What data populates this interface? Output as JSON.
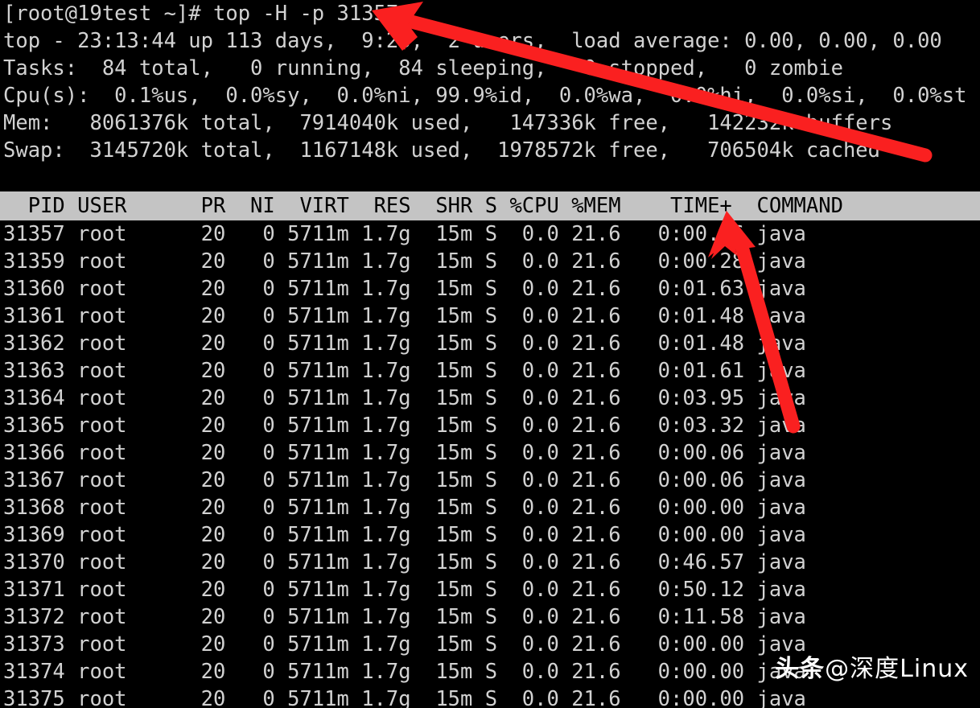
{
  "terminal": {
    "prompt_line": "[root@19test ~]# top -H -p 31357",
    "summary": [
      "top - 23:13:44 up 113 days,  9:23,  2 users,  load average: 0.00, 0.00, 0.00",
      "Tasks:  84 total,   0 running,  84 sleeping,   0 stopped,   0 zombie",
      "Cpu(s):  0.1%us,  0.0%sy,  0.0%ni, 99.9%id,  0.0%wa,  0.0%hi,  0.0%si,  0.0%st",
      "Mem:   8061376k total,  7914040k used,   147336k free,   142232k buffers",
      "Swap:  3145720k total,  1167148k used,  1978572k free,   706504k cached"
    ],
    "blank_line": "",
    "column_header": "  PID USER      PR  NI  VIRT  RES  SHR S %CPU %MEM    TIME+  COMMAND",
    "columns": [
      "PID",
      "USER",
      "PR",
      "NI",
      "VIRT",
      "RES",
      "SHR",
      "S",
      "%CPU",
      "%MEM",
      "TIME+",
      "COMMAND"
    ],
    "rows": [
      {
        "line": "31357 root      20   0 5711m 1.7g  15m S  0.0 21.6   0:00.16 java",
        "pid": "31357",
        "user": "root",
        "pr": "20",
        "ni": "0",
        "virt": "5711m",
        "res": "1.7g",
        "shr": "15m",
        "s": "S",
        "cpu": "0.0",
        "mem": "21.6",
        "time": "0:00.16",
        "command": "java"
      },
      {
        "line": "31359 root      20   0 5711m 1.7g  15m S  0.0 21.6   0:00.28 java",
        "pid": "31359",
        "user": "root",
        "pr": "20",
        "ni": "0",
        "virt": "5711m",
        "res": "1.7g",
        "shr": "15m",
        "s": "S",
        "cpu": "0.0",
        "mem": "21.6",
        "time": "0:00.28",
        "command": "java"
      },
      {
        "line": "31360 root      20   0 5711m 1.7g  15m S  0.0 21.6   0:01.63 java",
        "pid": "31360",
        "user": "root",
        "pr": "20",
        "ni": "0",
        "virt": "5711m",
        "res": "1.7g",
        "shr": "15m",
        "s": "S",
        "cpu": "0.0",
        "mem": "21.6",
        "time": "0:01.63",
        "command": "java"
      },
      {
        "line": "31361 root      20   0 5711m 1.7g  15m S  0.0 21.6   0:01.48 java",
        "pid": "31361",
        "user": "root",
        "pr": "20",
        "ni": "0",
        "virt": "5711m",
        "res": "1.7g",
        "shr": "15m",
        "s": "S",
        "cpu": "0.0",
        "mem": "21.6",
        "time": "0:01.48",
        "command": "java"
      },
      {
        "line": "31362 root      20   0 5711m 1.7g  15m S  0.0 21.6   0:01.48 java",
        "pid": "31362",
        "user": "root",
        "pr": "20",
        "ni": "0",
        "virt": "5711m",
        "res": "1.7g",
        "shr": "15m",
        "s": "S",
        "cpu": "0.0",
        "mem": "21.6",
        "time": "0:01.48",
        "command": "java"
      },
      {
        "line": "31363 root      20   0 5711m 1.7g  15m S  0.0 21.6   0:01.61 java",
        "pid": "31363",
        "user": "root",
        "pr": "20",
        "ni": "0",
        "virt": "5711m",
        "res": "1.7g",
        "shr": "15m",
        "s": "S",
        "cpu": "0.0",
        "mem": "21.6",
        "time": "0:01.61",
        "command": "java"
      },
      {
        "line": "31364 root      20   0 5711m 1.7g  15m S  0.0 21.6   0:03.95 java",
        "pid": "31364",
        "user": "root",
        "pr": "20",
        "ni": "0",
        "virt": "5711m",
        "res": "1.7g",
        "shr": "15m",
        "s": "S",
        "cpu": "0.0",
        "mem": "21.6",
        "time": "0:03.95",
        "command": "java"
      },
      {
        "line": "31365 root      20   0 5711m 1.7g  15m S  0.0 21.6   0:03.32 java",
        "pid": "31365",
        "user": "root",
        "pr": "20",
        "ni": "0",
        "virt": "5711m",
        "res": "1.7g",
        "shr": "15m",
        "s": "S",
        "cpu": "0.0",
        "mem": "21.6",
        "time": "0:03.32",
        "command": "java"
      },
      {
        "line": "31366 root      20   0 5711m 1.7g  15m S  0.0 21.6   0:00.06 java",
        "pid": "31366",
        "user": "root",
        "pr": "20",
        "ni": "0",
        "virt": "5711m",
        "res": "1.7g",
        "shr": "15m",
        "s": "S",
        "cpu": "0.0",
        "mem": "21.6",
        "time": "0:00.06",
        "command": "java"
      },
      {
        "line": "31367 root      20   0 5711m 1.7g  15m S  0.0 21.6   0:00.06 java",
        "pid": "31367",
        "user": "root",
        "pr": "20",
        "ni": "0",
        "virt": "5711m",
        "res": "1.7g",
        "shr": "15m",
        "s": "S",
        "cpu": "0.0",
        "mem": "21.6",
        "time": "0:00.06",
        "command": "java"
      },
      {
        "line": "31368 root      20   0 5711m 1.7g  15m S  0.0 21.6   0:00.00 java",
        "pid": "31368",
        "user": "root",
        "pr": "20",
        "ni": "0",
        "virt": "5711m",
        "res": "1.7g",
        "shr": "15m",
        "s": "S",
        "cpu": "0.0",
        "mem": "21.6",
        "time": "0:00.00",
        "command": "java"
      },
      {
        "line": "31369 root      20   0 5711m 1.7g  15m S  0.0 21.6   0:00.00 java",
        "pid": "31369",
        "user": "root",
        "pr": "20",
        "ni": "0",
        "virt": "5711m",
        "res": "1.7g",
        "shr": "15m",
        "s": "S",
        "cpu": "0.0",
        "mem": "21.6",
        "time": "0:00.00",
        "command": "java"
      },
      {
        "line": "31370 root      20   0 5711m 1.7g  15m S  0.0 21.6   0:46.57 java",
        "pid": "31370",
        "user": "root",
        "pr": "20",
        "ni": "0",
        "virt": "5711m",
        "res": "1.7g",
        "shr": "15m",
        "s": "S",
        "cpu": "0.0",
        "mem": "21.6",
        "time": "0:46.57",
        "command": "java"
      },
      {
        "line": "31371 root      20   0 5711m 1.7g  15m S  0.0 21.6   0:50.12 java",
        "pid": "31371",
        "user": "root",
        "pr": "20",
        "ni": "0",
        "virt": "5711m",
        "res": "1.7g",
        "shr": "15m",
        "s": "S",
        "cpu": "0.0",
        "mem": "21.6",
        "time": "0:50.12",
        "command": "java"
      },
      {
        "line": "31372 root      20   0 5711m 1.7g  15m S  0.0 21.6   0:11.58 java",
        "pid": "31372",
        "user": "root",
        "pr": "20",
        "ni": "0",
        "virt": "5711m",
        "res": "1.7g",
        "shr": "15m",
        "s": "S",
        "cpu": "0.0",
        "mem": "21.6",
        "time": "0:11.58",
        "command": "java"
      },
      {
        "line": "31373 root      20   0 5711m 1.7g  15m S  0.0 21.6   0:00.00 java",
        "pid": "31373",
        "user": "root",
        "pr": "20",
        "ni": "0",
        "virt": "5711m",
        "res": "1.7g",
        "shr": "15m",
        "s": "S",
        "cpu": "0.0",
        "mem": "21.6",
        "time": "0:00.00",
        "command": "java"
      },
      {
        "line": "31374 root      20   0 5711m 1.7g  15m S  0.0 21.6   0:00.00 java",
        "pid": "31374",
        "user": "root",
        "pr": "20",
        "ni": "0",
        "virt": "5711m",
        "res": "1.7g",
        "shr": "15m",
        "s": "S",
        "cpu": "0.0",
        "mem": "21.6",
        "time": "0:00.00",
        "command": "java"
      },
      {
        "line": "31375 root      20   0 5711m 1.7g  15m S  0.0 21.6   0:00.00 java",
        "pid": "31375",
        "user": "root",
        "pr": "20",
        "ni": "0",
        "virt": "5711m",
        "res": "1.7g",
        "shr": "15m",
        "s": "S",
        "cpu": "0.0",
        "mem": "21.6",
        "time": "0:00.00",
        "command": "java"
      }
    ]
  },
  "annotations": {
    "arrow_color": "#fa2020",
    "arrow_1_target": "top -H -p 31357 command",
    "arrow_2_target": "COMMAND column header"
  },
  "watermark": {
    "prefix": "头条",
    "handle": "@深度Linux"
  },
  "colors": {
    "background": "#000000",
    "text": "#d2d2d2",
    "header_band_bg": "#c4c4c4",
    "header_band_text": "#000000",
    "arrow": "#fa2020"
  }
}
